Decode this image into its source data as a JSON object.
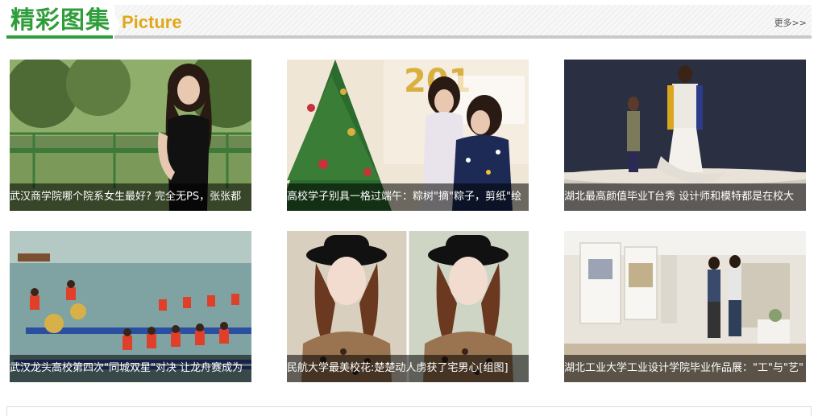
{
  "section": {
    "title_cn": "精彩图集",
    "title_en": "Picture",
    "more_label": "更多>>",
    "accent_color": "#2f9e3a",
    "title_en_color": "#e0a817"
  },
  "gallery": {
    "items": [
      {
        "caption": "武汉商学院哪个院系女生最好? 完全无PS，张张都"
      },
      {
        "caption": "高校学子别具一格过端午：粽树\"摘\"粽子，剪纸\"绘"
      },
      {
        "caption": "湖北最高颜值毕业T台秀 设计师和模特都是在校大"
      },
      {
        "caption": "武汉龙头高校第四次\"同城双星\"对决 让龙舟赛成为"
      },
      {
        "caption": "民航大学最美校花:楚楚动人虏获了宅男心[组图]"
      },
      {
        "caption": "湖北工业大学工业设计学院毕业作品展：\"工\"与\"艺\""
      }
    ]
  }
}
